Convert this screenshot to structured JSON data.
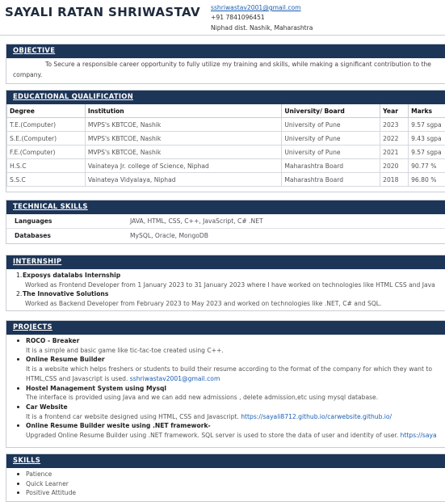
{
  "header": {
    "name": "SAYALI RATAN SHRIWASTAV",
    "email": "sshriwastav2001@gmail.com",
    "phone": "+91 7841096451",
    "location": "Niphad dist. Nashik, Maharashtra"
  },
  "objective": {
    "heading": "OBJECTIVE",
    "line1": "To Secure a responsible career opportunity to fully utilize my training and skills, while making a significant contribution to the",
    "line2": "company."
  },
  "education": {
    "heading": "EDUCATIONAL QUALIFICATION",
    "columns": [
      "Degree",
      "Institution",
      "University/ Board",
      "Year",
      "Marks"
    ],
    "rows": [
      [
        "T.E.(Computer)",
        "MVPS's KBTCOE, Nashik",
        "University of Pune",
        "2023",
        "9.57 sgpa"
      ],
      [
        "S.E.(Computer)",
        "MVPS's KBTCOE, Nashik",
        "University of Pune",
        "2022",
        "9.43 sgpa"
      ],
      [
        "F.E.(Computer)",
        "MVPS's KBTCOE, Nashik",
        "University of Pune",
        "2021",
        "9.57 sgpa"
      ],
      [
        "H.S.C",
        "Vainateya Jr. college of Science, Niphad",
        "Maharashtra Board",
        "2020",
        "90.77 %"
      ],
      [
        "S.S.C",
        "Vainateya Vidyalaya, Niphad",
        "Maharashtra Board",
        "2018",
        "96.80 %"
      ]
    ]
  },
  "technical": {
    "heading": "TECHNICAL SKILLS",
    "rows": [
      {
        "key": "Languages",
        "value": "JAVA, HTML, CSS, C++, JavaScript, C# .NET"
      },
      {
        "key": "Databases",
        "value": "MySQL, Oracle, MongoDB"
      }
    ]
  },
  "internship": {
    "heading": "INTERNSHIP",
    "items": [
      {
        "num": "1.",
        "title": "Exposys datalabs Internship",
        "desc": "Worked as Frontend Developer from 1 January 2023 to 31 January 2023 where I have worked on technologies like HTML CSS and Java"
      },
      {
        "num": "2.",
        "title": "The Innovative Solutions",
        "desc": "Worked as Backend Developer from February 2023 to May 2023 and worked on technologies like .NET, C# and SQL."
      }
    ]
  },
  "projects": {
    "heading": "PROJECTS",
    "items": [
      {
        "title": "ROCO - Breaker",
        "line1": "It is a simple and basic game like tic-tac-toe created using C++.",
        "line2": "",
        "link": ""
      },
      {
        "title": "Online Resume Builder",
        "line1": "It is a website which helps freshers or students to build their resume according to the format of the company for which they want to",
        "line2": "HTML,CSS and Javascript is used. ",
        "link": "sshriwastav2001@gmail.com"
      },
      {
        "title": "Hostel Management System using Mysql",
        "line1": "The interface is provided using Java and we can add new admissions , delete admission,etc using mysql database.",
        "line2": "",
        "link": ""
      },
      {
        "title": "Car Website",
        "line1": "It is a frontend car website designed using HTML, CSS and Javascript. ",
        "line2": "",
        "link": "https://sayali8712.github.io/carwebsite.github.io/"
      },
      {
        "title": "Online Resume Builder wesite using .NET framework-",
        "line1": "Upgraded Online Resume Builder using .NET framework. SQL server is used to store the data of user and identity of user. ",
        "line2": "",
        "link": "https://saya"
      }
    ]
  },
  "skills": {
    "heading": "SKILLS",
    "items": [
      "Patience",
      "Quick Learner",
      "Positive Attitude"
    ]
  },
  "colors": {
    "section_header": "#1d3557",
    "link": "#1a5fb4"
  }
}
